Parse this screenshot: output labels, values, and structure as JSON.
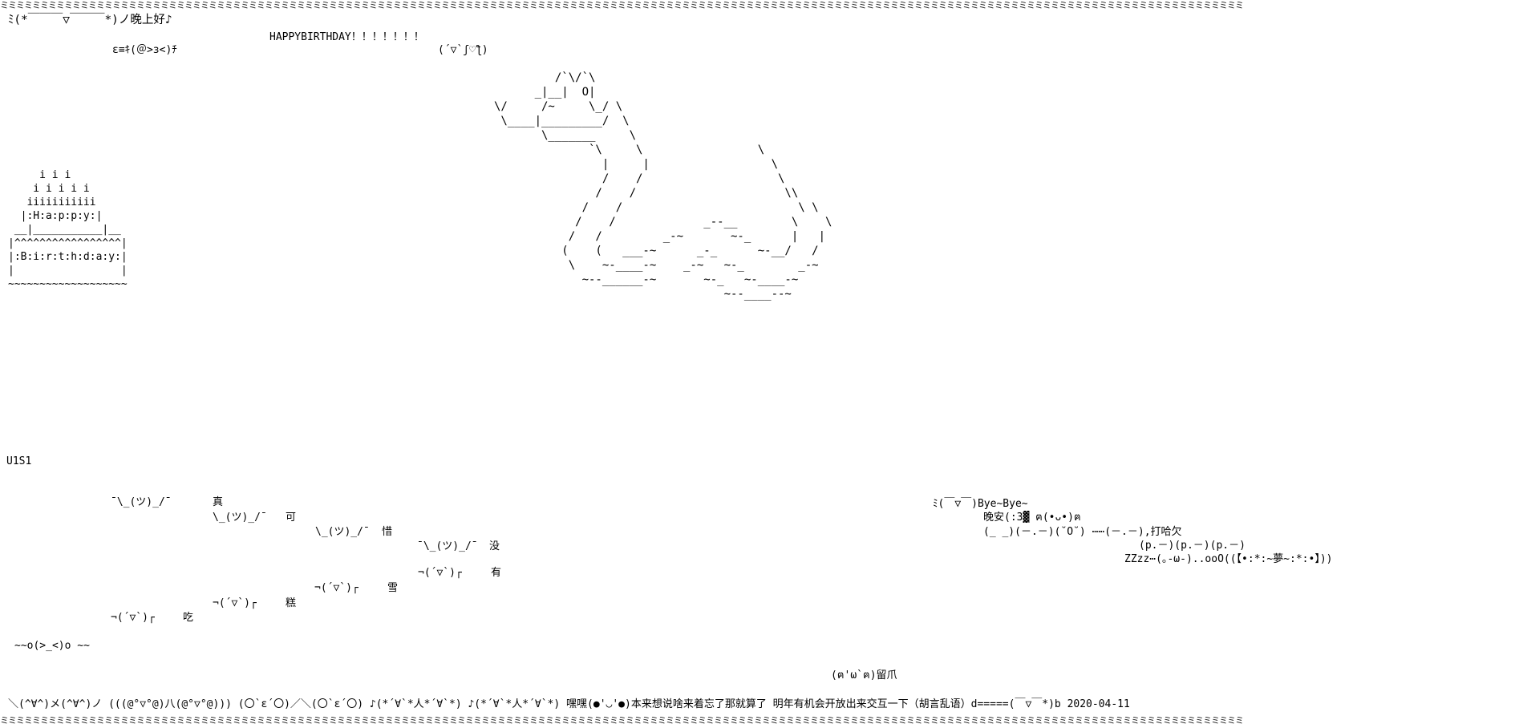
{
  "border": "ミミミミミミミミミミミミミミミミミミミミミミミミミミミミミミミミミミミミミミミミミミミミミミミミミミミミミミミミミミミミミミミミミミミミミミミミミミミミミミミミミミミミミミミミミミミミミミミミミミミミミミミミミミミミミミミミミミミミミミミミミミミミミミミミミミミミミミミミミミミミミミミミミミミミミミミミミミミ",
  "greeting": "ﾐ(*￣￣￣▽￣￣￣*)ノ晚上好♪",
  "bee_face": "ε≡ｷ(＠>з<)ﾁ",
  "birthday": "HAPPYBIRTHDAY！！！！！！！",
  "heart_face": "(´▽`ʃ♡ƪ)",
  "snake_art": "         /`\\/`\\\n      _|__|  O|\n\\/     /~     \\_/ \\\n \\____|_________/  \\\n       \\_______     \\\n              `\\     \\                 \\\n                |     |                  \\\n                /    /                    \\\n               /    /                      \\\\\n             /    /                          \\ \\\n            /    /             _--__        \\    \\\n           /   /         _-~       ~-_      |   |\n          (    (   ___-~      _-_      ~-__/   /\n           \\    ~-____-~    _-~   ~-_        _-~\n             ~--______-~       ~-_   ~-____-~\n                                  ~--____--~",
  "cake_art": "     i i i\n    i i i i i\n   iiiiiiiiiii\n  |:H:a:p:p:y:|\n __|___________|__\n|^^^^^^^^^^^^^^^^^|\n|:B:i:r:t:h:d:a:y:|\n|                 |\n~~~~~~~~~~~~~~~~~~~",
  "user": "U1S1",
  "shrugs": [
    {
      "face": "¯\\_(ツ)_/¯",
      "word": "真"
    },
    {
      "face": "\\_(ツ)_/¯",
      "word": "可"
    },
    {
      "face": "\\_(ツ)_/¯",
      "word": "惜"
    },
    {
      "face": "¯\\_(ツ)_/¯",
      "word": "没"
    }
  ],
  "dances": [
    {
      "face": "¬(´▽`)┌",
      "word": "有"
    },
    {
      "face": "¬(´▽`)┌",
      "word": "雪"
    },
    {
      "face": "¬(´▽`)┌",
      "word": "糕"
    },
    {
      "face": "¬(´▽`)┌",
      "word": "吃"
    }
  ],
  "wave": "~~o(>_<)o ~~",
  "bye": "ﾐ(￣▽￣)Bye~Bye~",
  "goodnight": "晚安(:3▓ ฅ(•ᴗ•)ฅ",
  "yawn": "(_ _)(－.－)(˘O˘) ⋯⋯(－.－),打哈欠",
  "sleepy": "(p.－)(p.－)(p.－)",
  "zzz": "ZZzz⋯(｡-ω-)..ooO((【•:*:~夢~:*:•】))",
  "paw": "(ฅ'ω`ฅ)留爪",
  "footer": "＼(^∀^)メ(^∀^)ノ (((@°▽°@)八(@°▽°@))) (〇`ε´〇)／＼(〇`ε´〇) ♪(*´∀`*人*´∀`*) ♪(*´∀`*人*´∀`*) 嘿嘿(●'◡'●)本来想说啥来着忘了那就算了 明年有机会开放出来交互一下（胡言乱语）d=====(￣▽￣*)b 2020-04-11"
}
